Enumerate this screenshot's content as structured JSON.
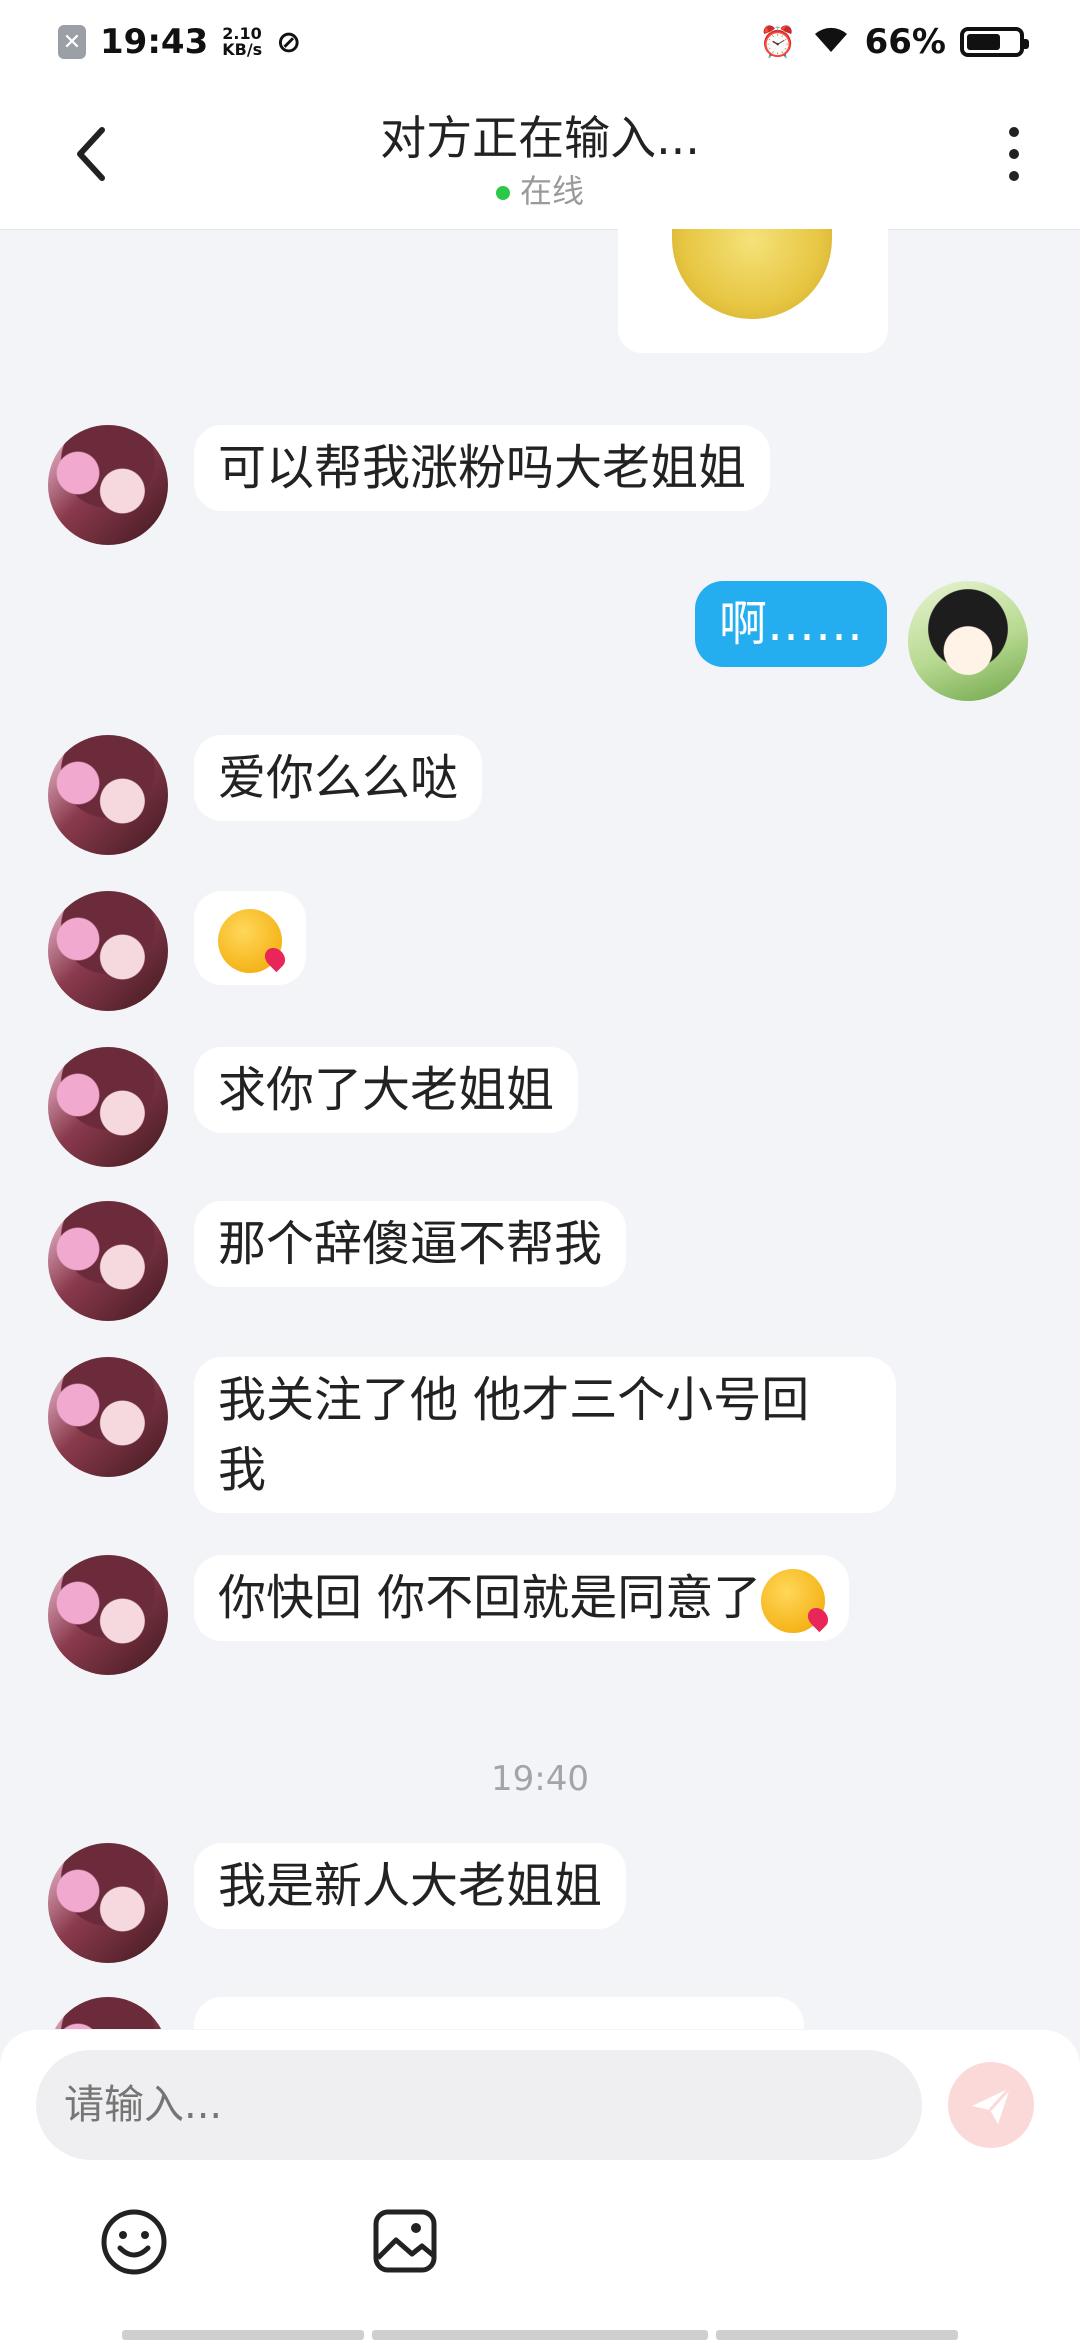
{
  "status_bar": {
    "time": "19:43",
    "speed_value": "2.10",
    "speed_unit": "KB/s",
    "battery": "66%",
    "battery_level": 0.66
  },
  "header": {
    "title": "对方正在输入...",
    "status": "在线"
  },
  "messages": [
    {
      "from": "other",
      "text": "可以帮我涨粉吗大老姐姐"
    },
    {
      "from": "me",
      "text": "啊……"
    },
    {
      "from": "other",
      "text": "爱你么么哒"
    },
    {
      "from": "other",
      "emoji": "kissing-face"
    },
    {
      "from": "other",
      "text": "求你了大老姐姐"
    },
    {
      "from": "other",
      "text": "那个辞傻逼不帮我"
    },
    {
      "from": "other",
      "line1": "我关注了他 他才三个小号回",
      "line2": "我"
    },
    {
      "from": "other",
      "text": "你快回 你不回就是同意了",
      "emoji": "kissing-face"
    },
    {
      "from": "other",
      "text": "我是新人大老姐姐"
    }
  ],
  "timestamp": "19:40",
  "input": {
    "placeholder": "请输入..."
  }
}
